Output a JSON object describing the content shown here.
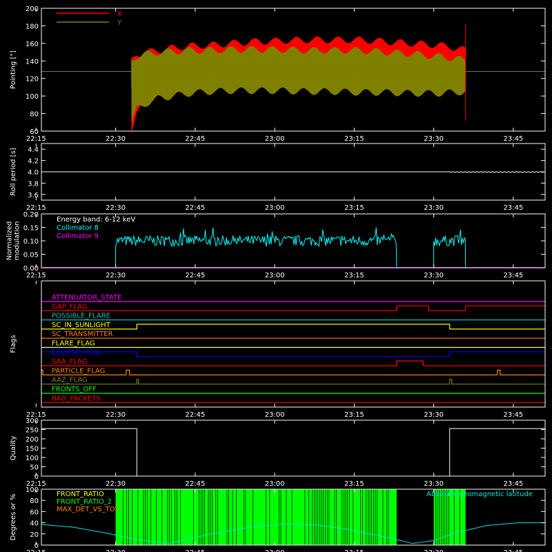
{
  "colors": {
    "background": "#000000",
    "axes": "#ffffff",
    "x_pointing": "#ff0000",
    "y_pointing": "#808000",
    "collimator_8": "#00ffff",
    "collimator_9": "#ff00ff",
    "front_ratio": "#ffff00",
    "front_ratio_2": "#00ff00",
    "max_det_vs_tot": "#ff8000",
    "geomag": "#00e5e5"
  },
  "chart_data": [
    {
      "type": "area",
      "name": "pointing",
      "ylabel": "Pointing [\"]",
      "ylim": [
        60,
        200
      ],
      "yticks": [
        60,
        80,
        100,
        120,
        140,
        160,
        180,
        200
      ],
      "xlabels": [
        "22:15",
        "22:30",
        "22:45",
        "23:00",
        "23:15",
        "23:30",
        "23:45"
      ],
      "xrange_minutes": [
        0,
        95
      ],
      "legend": [
        {
          "label": "X",
          "color": "#ff0000"
        },
        {
          "label": "Y",
          "color": "#808000"
        }
      ],
      "baseline": 128,
      "data_start": 17,
      "data_end": 80,
      "series": [
        {
          "name": "X",
          "x": [
            17,
            18,
            20,
            22,
            25,
            28,
            32,
            36,
            40,
            45,
            50,
            55,
            60,
            65,
            70,
            75,
            78,
            80
          ],
          "upper": [
            140,
            148,
            150,
            152,
            155,
            157,
            158,
            160,
            162,
            163,
            164,
            164,
            164,
            162,
            160,
            158,
            155,
            152
          ],
          "lower": [
            62,
            80,
            95,
            100,
            108,
            112,
            115,
            118,
            120,
            122,
            124,
            125,
            126,
            127,
            128,
            128,
            126,
            125
          ]
        },
        {
          "name": "Y",
          "x": [
            17,
            18,
            20,
            22,
            25,
            28,
            32,
            36,
            40,
            45,
            50,
            55,
            60,
            65,
            70,
            75,
            78,
            80
          ],
          "upper": [
            140,
            146,
            148,
            150,
            151,
            152,
            152,
            153,
            153,
            153,
            152,
            152,
            152,
            150,
            148,
            145,
            143,
            140
          ],
          "lower": [
            70,
            85,
            92,
            97,
            100,
            103,
            105,
            106,
            106,
            106,
            105,
            105,
            104,
            104,
            103,
            103,
            104,
            105
          ]
        }
      ]
    },
    {
      "type": "line",
      "name": "roll_period",
      "ylabel": "Roll period [s]",
      "ylim": [
        3.5,
        4.5
      ],
      "yticks": [
        "3.6",
        "3.8",
        "4.0",
        "4.2",
        "4.4"
      ],
      "xlabels": [
        "22:15",
        "22:30",
        "22:45",
        "23:00",
        "23:15",
        "23:30",
        "23:45"
      ],
      "series": [
        {
          "name": "roll",
          "value": 4.0
        }
      ]
    },
    {
      "type": "line",
      "name": "modulation",
      "ylabel": "Normalized modulation",
      "ylim": [
        0,
        0.2
      ],
      "yticks": [
        "0.00",
        "0.05",
        "0.10",
        "0.15",
        "0.20"
      ],
      "xlabels": [
        "22:15",
        "22:30",
        "22:45",
        "23:00",
        "23:15",
        "23:30",
        "23:45"
      ],
      "annotation": "Energy band: 6-12 keV",
      "series": [
        {
          "name": "Collimator 8",
          "segments": [
            [
              14,
              67
            ],
            [
              74,
              80
            ]
          ],
          "mean": 0.1
        },
        {
          "name": "Collimator 9",
          "value": 0.0
        }
      ]
    },
    {
      "type": "line",
      "name": "flags",
      "ylabel": "Flags",
      "xlabels": [
        "22:15",
        "22:30",
        "22:45",
        "23:00",
        "23:15",
        "23:30",
        "23:45"
      ],
      "flags": [
        {
          "name": "ATTENUATOR_STATE",
          "color": "#ff00ff",
          "high": []
        },
        {
          "name": "GAP_FLAG",
          "color": "#ff0000",
          "high": [
            [
              67,
              73
            ],
            [
              80,
              95
            ]
          ]
        },
        {
          "name": "POSSIBLE_FLARE",
          "color": "#00c0c0",
          "high": []
        },
        {
          "name": "SC_IN_SUNLIGHT",
          "color": "#ffff00",
          "high": [
            [
              18,
              77
            ]
          ]
        },
        {
          "name": "SC_TRANSMITTER",
          "color": "#ff8000",
          "high": []
        },
        {
          "name": "FLARE_FLAG",
          "color": "#ffff00",
          "high": []
        },
        {
          "name": "ECLIPSE_FLAG",
          "color": "#0000ff",
          "high": [
            [
              0,
              18
            ],
            [
              77,
              95
            ]
          ]
        },
        {
          "name": "SAA_FLAG",
          "color": "#ff0000",
          "high": [
            [
              67,
              72
            ]
          ]
        },
        {
          "name": "PARTICLE_FLAG",
          "color": "#ff8000",
          "high": [
            [
              0,
              0.3
            ],
            [
              16,
              16.6
            ],
            [
              86,
              86.5
            ]
          ]
        },
        {
          "name": "AAZ_FLAG",
          "color": "#808000",
          "high": [
            [
              18,
              18.3
            ],
            [
              77,
              77.4
            ]
          ]
        },
        {
          "name": "FRONTS_OFF",
          "color": "#00ff00",
          "high": []
        },
        {
          "name": "BAD_PACKETS",
          "color": "#ff0000",
          "high": []
        }
      ]
    },
    {
      "type": "line",
      "name": "quality",
      "ylabel": "Quality",
      "ylim": [
        0,
        300
      ],
      "yticks": [
        0,
        50,
        100,
        150,
        200,
        250,
        300
      ],
      "xlabels": [
        "22:15",
        "22:30",
        "22:45",
        "23:00",
        "23:15",
        "23:30",
        "23:45"
      ],
      "series": [
        {
          "name": "quality",
          "x": [
            0,
            18,
            18,
            77,
            77,
            95
          ],
          "y": [
            255,
            255,
            0,
            0,
            255,
            255
          ]
        }
      ]
    },
    {
      "type": "bar",
      "name": "ratios",
      "ylabel": "Degrees or %",
      "ylim": [
        0,
        100
      ],
      "yticks": [
        0,
        20,
        40,
        60,
        80,
        100
      ],
      "xlabels": [
        "22:15",
        "22:30",
        "22:45",
        "23:00",
        "23:15",
        "23:30",
        "23:45"
      ],
      "legend": [
        {
          "label": "FRONT_RATIO",
          "color": "#ffff00"
        },
        {
          "label": "FRONT_RATIO_2",
          "color": "#00ff00"
        },
        {
          "label": "MAX_DET_VS_TOT",
          "color": "#ff8000"
        }
      ],
      "annotation": "Absolute geomagnetic latitude",
      "bar_segments": [
        [
          14,
          67
        ],
        [
          74,
          80
        ]
      ],
      "geomag": {
        "x": [
          0,
          6,
          12,
          18,
          24,
          32,
          40,
          46,
          52,
          58,
          62,
          66,
          70,
          74,
          78,
          84,
          90,
          95
        ],
        "y": [
          37,
          32,
          22,
          10,
          3,
          20,
          33,
          38,
          36,
          28,
          20,
          12,
          3,
          8,
          22,
          35,
          40,
          40
        ]
      }
    }
  ]
}
